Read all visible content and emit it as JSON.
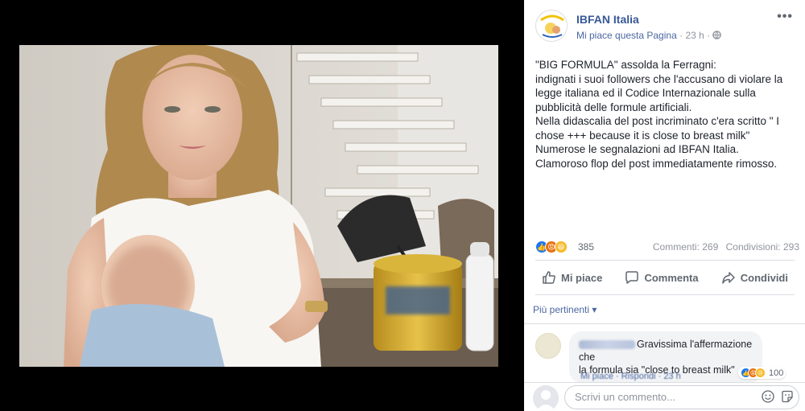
{
  "post": {
    "page_name": "IBFAN Italia",
    "like_page": "Mi piace questa Pagina",
    "time": "23 h",
    "separator": "·",
    "lines": [
      "\"BIG FORMULA\" assolda la Ferragni:",
      "indignati i suoi followers che l'accusano di violare la",
      "legge italiana ed il Codice Internazionale sulla",
      "pubblicità delle formule artificiali.",
      "Nella didascalia del post incriminato c'era scritto \" I",
      "chose +++ because it is close to breast milk\"",
      "Numerose le segnalazioni ad IBFAN Italia.",
      "Clamoroso flop del post immediatamente rimosso."
    ]
  },
  "stats": {
    "reactions": "385",
    "comments": "Commenti: 269",
    "shares": "Condivisioni: 293"
  },
  "actions": {
    "like": "Mi piace",
    "comment": "Commenta",
    "share": "Condividi"
  },
  "comments": {
    "filter": "Più pertinenti ▾",
    "first": {
      "text_line1": "Gravissima l'affermazione che",
      "text_line2": "la formula sia \"close to breast milk\"",
      "reactions": "100",
      "links": "Mi piace · Rispondi · 23 h"
    }
  },
  "composer": {
    "placeholder": "Scrivi un commento..."
  },
  "colors": {
    "brand_link": "#385898",
    "secondary_text": "#90949c",
    "like_blue": "#1877f2",
    "angry_orange": "#e9710f",
    "haha_yellow": "#f7b928"
  }
}
